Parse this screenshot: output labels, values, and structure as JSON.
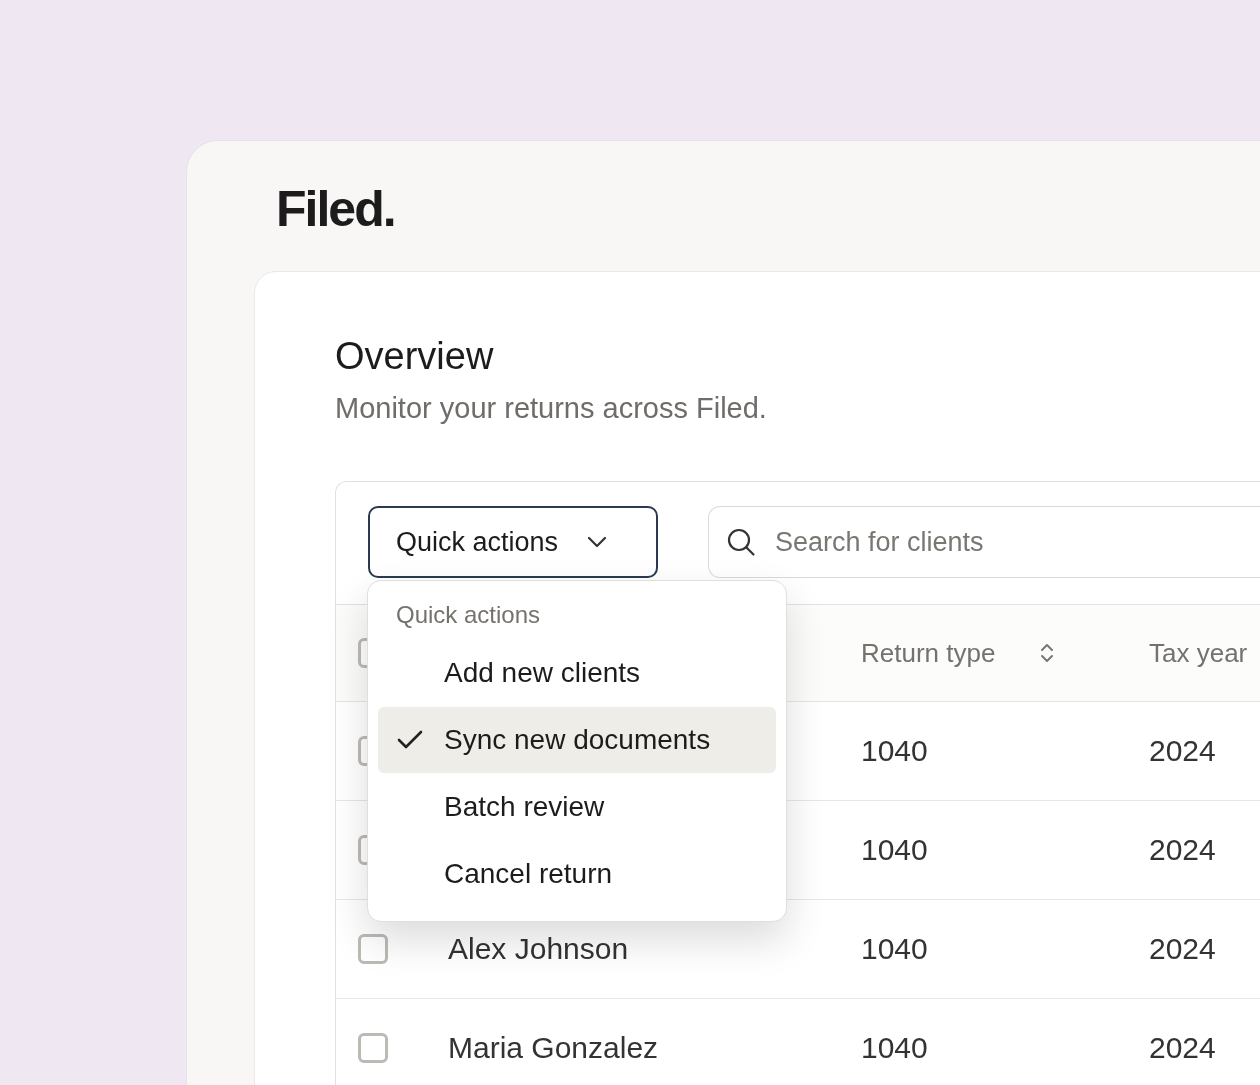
{
  "logo": "Filed.",
  "page": {
    "title": "Overview",
    "subtitle": "Monitor your returns across Filed."
  },
  "toolbar": {
    "quick_actions_button": "Quick actions",
    "search": {
      "placeholder": "Search for clients"
    }
  },
  "table": {
    "header_checked": false,
    "columns": [
      {
        "label": "Return type",
        "sortable": true
      },
      {
        "label": "Tax year"
      }
    ],
    "rows": [
      {
        "checked": false,
        "return_type": "1040",
        "tax_year": "2024"
      },
      {
        "checked": false,
        "return_type": "1040",
        "tax_year": "2024"
      },
      {
        "checked": false,
        "name": "Alex Johnson",
        "return_type": "1040",
        "tax_year": "2024"
      },
      {
        "checked": false,
        "name": "Maria Gonzalez",
        "return_type": "1040",
        "tax_year": "2024"
      }
    ]
  },
  "dropdown": {
    "heading": "Quick actions",
    "items": [
      {
        "label": "Add new clients",
        "selected": false
      },
      {
        "label": "Sync new documents",
        "selected": true
      },
      {
        "label": "Batch review",
        "selected": false
      },
      {
        "label": "Cancel return",
        "selected": false
      }
    ]
  }
}
